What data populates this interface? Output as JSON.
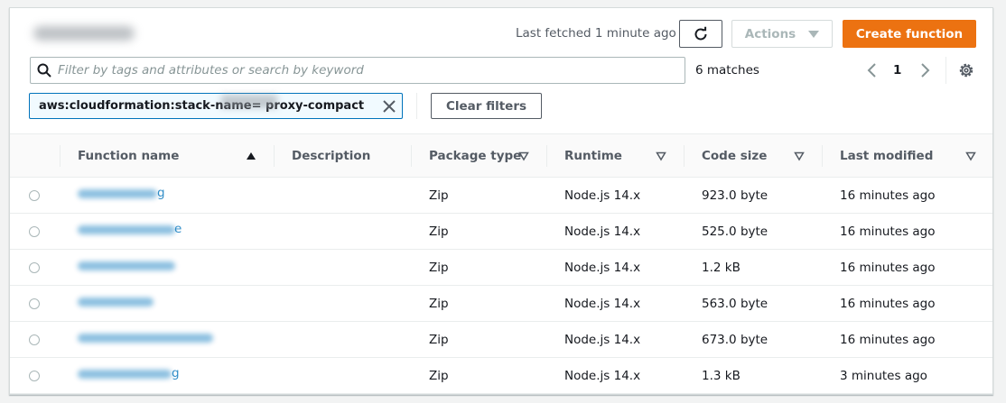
{
  "header": {
    "last_fetched": "Last fetched 1 minute ago",
    "actions_label": "Actions",
    "create_label": "Create function"
  },
  "search": {
    "placeholder": "Filter by tags and attributes or search by keyword",
    "value": "",
    "matches": "6 matches"
  },
  "pagination": {
    "page": "1"
  },
  "filter": {
    "token": "aws:cloudformation:stack-name=            proxy-compact",
    "clear_label": "Clear filters"
  },
  "table": {
    "columns": [
      "Function name",
      "Description",
      "Package type",
      "Runtime",
      "Code size",
      "Last modified"
    ],
    "rows": [
      {
        "name_suffix": "g",
        "description": "",
        "package": "Zip",
        "runtime": "Node.js 14.x",
        "size": "923.0 byte",
        "modified": "16 minutes ago"
      },
      {
        "name_suffix": "e",
        "description": "",
        "package": "Zip",
        "runtime": "Node.js 14.x",
        "size": "525.0 byte",
        "modified": "16 minutes ago"
      },
      {
        "name_suffix": "",
        "description": "",
        "package": "Zip",
        "runtime": "Node.js 14.x",
        "size": "1.2 kB",
        "modified": "16 minutes ago"
      },
      {
        "name_suffix": "",
        "description": "",
        "package": "Zip",
        "runtime": "Node.js 14.x",
        "size": "563.0 byte",
        "modified": "16 minutes ago"
      },
      {
        "name_suffix": "",
        "description": "",
        "package": "Zip",
        "runtime": "Node.js 14.x",
        "size": "673.0 byte",
        "modified": "16 minutes ago"
      },
      {
        "name_suffix": "g",
        "description": "",
        "package": "Zip",
        "runtime": "Node.js 14.x",
        "size": "1.3 kB",
        "modified": "3 minutes ago"
      }
    ]
  },
  "icons": {
    "refresh": "refresh-icon",
    "caret": "caret-down-icon",
    "search": "search-icon",
    "prev": "chevron-left-icon",
    "next": "chevron-right-icon",
    "settings": "gear-icon",
    "close": "close-icon",
    "sort_asc": "sort-ascending-icon",
    "sort": "sort-icon"
  },
  "colors": {
    "primary": "#ec7211",
    "link": "#0073bb",
    "border": "#d5dbdb"
  }
}
